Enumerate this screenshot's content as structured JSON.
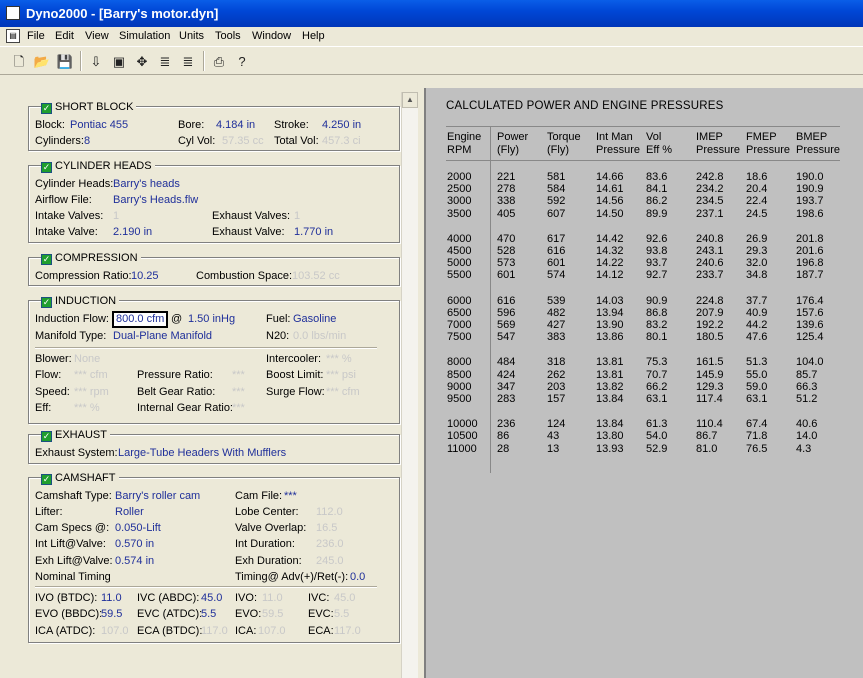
{
  "window": {
    "title": "Dyno2000 - [Barry's motor.dyn]"
  },
  "menu": [
    "File",
    "Edit",
    "View",
    "Simulation",
    "Units",
    "Tools",
    "Window",
    "Help"
  ],
  "toolbar": {
    "buttons": [
      "new-icon",
      "open-icon",
      "save-icon",
      "run-icon",
      "copy-icon",
      "compare-icon",
      "graph-icon",
      "print-icon",
      "help-icon"
    ],
    "glyphs": [
      "🗋",
      "📂",
      "💾",
      "⇩",
      "▣",
      "✥",
      "≣",
      "⎙",
      "?"
    ]
  },
  "check_glyph": "✓",
  "short_block": {
    "title": "SHORT BLOCK",
    "block_label": "Block:",
    "block_value": "Pontiac 455",
    "bore_label": "Bore:",
    "bore_value": "4.184 in",
    "stroke_label": "Stroke:",
    "stroke_value": "4.250 in",
    "cylinders_label": "Cylinders:",
    "cylinders_value": "8",
    "cylvol_label": "Cyl Vol:",
    "cylvol_value": "57.35 cc",
    "totalvol_label": "Total Vol:",
    "totalvol_value": "457.3 ci"
  },
  "cylinder_heads": {
    "title": "CYLINDER HEADS",
    "heads_label": "Cylinder Heads:",
    "heads_value": "Barry's heads",
    "airflow_label": "Airflow File:",
    "airflow_value": "Barry's Heads.flw",
    "intake_valves_label": "Intake Valves:",
    "intake_valves_value": "1",
    "exhaust_valves_label": "Exhaust Valves:",
    "exhaust_valves_value": "1",
    "intake_valve_label": "Intake Valve:",
    "intake_valve_value": "2.190 in",
    "exhaust_valve_label": "Exhaust Valve:",
    "exhaust_valve_value": "1.770 in"
  },
  "compression": {
    "title": "COMPRESSION",
    "ratio_label": "Compression Ratio:",
    "ratio_value": "10.25",
    "space_label": "Combustion Space:",
    "space_value": "103.52 cc"
  },
  "induction": {
    "title": "INDUCTION",
    "flow_label": "Induction Flow:",
    "flow_value": "800.0 cfm",
    "at": "@",
    "flow_pressure": "1.50 inHg",
    "fuel_label": "Fuel:",
    "fuel_value": "Gasoline",
    "manifold_label": "Manifold Type:",
    "manifold_value": "Dual-Plane Manifold",
    "n20_label": "N20:",
    "n20_value": "0.0 lbs/min",
    "blower_label": "Blower:",
    "blower_value": "None",
    "intercooler_label": "Intercooler:",
    "intercooler_value": "*** %",
    "flow2_label": "Flow:",
    "flow2_value": "*** cfm",
    "pressure_ratio_label": "Pressure Ratio:",
    "pressure_ratio_value": "***",
    "boost_label": "Boost Limit:",
    "boost_value": "*** psi",
    "speed_label": "Speed:",
    "speed_value": "*** rpm",
    "belt_label": "Belt Gear Ratio:",
    "belt_value": "***",
    "surge_label": "Surge Flow:",
    "surge_value": "*** cfm",
    "eff_label": "Eff:",
    "eff_value": "*** %",
    "internal_label": "Internal Gear Ratio:",
    "internal_value": "***"
  },
  "exhaust": {
    "title": "EXHAUST",
    "system_label": "Exhaust System:",
    "system_value": "Large-Tube Headers With Mufflers"
  },
  "camshaft": {
    "title": "CAMSHAFT",
    "type_label": "Camshaft Type:",
    "type_value": "Barry's roller cam",
    "file_label": "Cam File:",
    "file_value": "***",
    "lifter_label": "Lifter:",
    "lifter_value": "Roller",
    "lobe_label": "Lobe Center:",
    "lobe_value": "112.0",
    "specs_label": "Cam Specs @:",
    "specs_value": "0.050-Lift",
    "overlap_label": "Valve Overlap:",
    "overlap_value": "16.5",
    "int_lift_label": "Int Lift@Valve:",
    "int_lift_value": "0.570 in",
    "int_dur_label": "Int Duration:",
    "int_dur_value": "236.0",
    "exh_lift_label": "Exh Lift@Valve:",
    "exh_lift_value": "0.574 in",
    "exh_dur_label": "Exh Duration:",
    "exh_dur_value": "245.0",
    "nominal_label": "Nominal Timing",
    "timing_label": "Timing@ Adv(+)/Ret(-):",
    "timing_value": "0.0",
    "ivo_label": "IVO  (BTDC):",
    "ivo_value": "11.0",
    "ivc_label": "IVC  (ABDC):",
    "ivc_value": "45.0",
    "ivo2_label": "IVO:",
    "ivo2_value": "11.0",
    "ivc2_label": "IVC:",
    "ivc2_value": "45.0",
    "evo_label": "EVO (BBDC):",
    "evo_value": "59.5",
    "evc_label": "EVC (ATDC):",
    "evc_value": "5.5",
    "evo2_label": "EVO:",
    "evo2_value": "59.5",
    "evc2_label": "EVC:",
    "evc2_value": "5.5",
    "ica_label": "ICA  (ATDC):",
    "ica_value": "107.0",
    "eca_label": "ECA (BTDC):",
    "eca_value": "117.0",
    "ica2_label": "ICA:",
    "ica2_value": "107.0",
    "eca2_label": "ECA:",
    "eca2_value": "117.0"
  },
  "results": {
    "title": "CALCULATED POWER AND ENGINE PRESSURES",
    "headers": [
      [
        "Engine",
        "RPM"
      ],
      [
        "Power",
        "(Fly)"
      ],
      [
        "Torque",
        "(Fly)"
      ],
      [
        "Int Man",
        "Pressure"
      ],
      [
        "Vol",
        "Eff %"
      ],
      [
        "IMEP",
        "Pressure"
      ],
      [
        "FMEP",
        "Pressure"
      ],
      [
        "BMEP",
        "Pressure"
      ]
    ],
    "rows": [
      [
        "2000",
        "221",
        "581",
        "14.66",
        "83.6",
        "242.8",
        "18.6",
        "190.0"
      ],
      [
        "2500",
        "278",
        "584",
        "14.61",
        "84.1",
        "234.2",
        "20.4",
        "190.9"
      ],
      [
        "3000",
        "338",
        "592",
        "14.56",
        "86.2",
        "234.5",
        "22.4",
        "193.7"
      ],
      [
        "3500",
        "405",
        "607",
        "14.50",
        "89.9",
        "237.1",
        "24.5",
        "198.6"
      ],
      [
        "4000",
        "470",
        "617",
        "14.42",
        "92.6",
        "240.8",
        "26.9",
        "201.8"
      ],
      [
        "4500",
        "528",
        "616",
        "14.32",
        "93.8",
        "243.1",
        "29.3",
        "201.6"
      ],
      [
        "5000",
        "573",
        "601",
        "14.22",
        "93.7",
        "240.6",
        "32.0",
        "196.8"
      ],
      [
        "5500",
        "601",
        "574",
        "14.12",
        "92.7",
        "233.7",
        "34.8",
        "187.7"
      ],
      [
        "6000",
        "616",
        "539",
        "14.03",
        "90.9",
        "224.8",
        "37.7",
        "176.4"
      ],
      [
        "6500",
        "596",
        "482",
        "13.94",
        "86.8",
        "207.9",
        "40.9",
        "157.6"
      ],
      [
        "7000",
        "569",
        "427",
        "13.90",
        "83.2",
        "192.2",
        "44.2",
        "139.6"
      ],
      [
        "7500",
        "547",
        "383",
        "13.86",
        "80.1",
        "180.5",
        "47.6",
        "125.4"
      ],
      [
        "8000",
        "484",
        "318",
        "13.81",
        "75.3",
        "161.5",
        "51.3",
        "104.0"
      ],
      [
        "8500",
        "424",
        "262",
        "13.81",
        "70.7",
        "145.9",
        "55.0",
        "85.7"
      ],
      [
        "9000",
        "347",
        "203",
        "13.82",
        "66.2",
        "129.3",
        "59.0",
        "66.3"
      ],
      [
        "9500",
        "283",
        "157",
        "13.84",
        "63.1",
        "117.4",
        "63.1",
        "51.2"
      ],
      [
        "10000",
        "236",
        "124",
        "13.84",
        "61.3",
        "110.4",
        "67.4",
        "40.6"
      ],
      [
        "10500",
        "86",
        "43",
        "13.80",
        "54.0",
        "86.7",
        "71.8",
        "14.0"
      ],
      [
        "11000",
        "28",
        "13",
        "13.93",
        "52.9",
        "81.0",
        "76.5",
        "4.3"
      ]
    ]
  }
}
